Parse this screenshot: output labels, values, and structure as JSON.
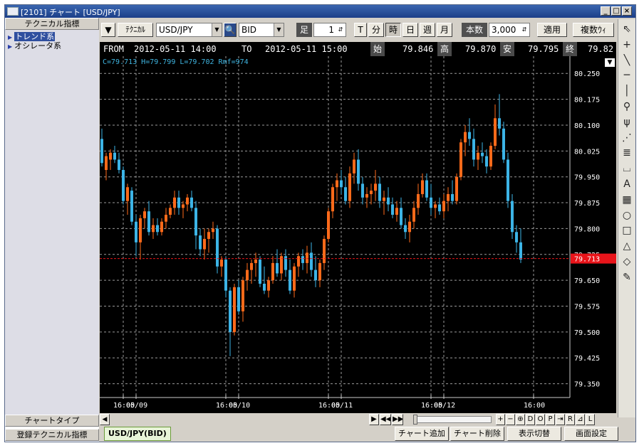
{
  "window": {
    "title": "[2101] チャート [USD/JPY]"
  },
  "left_panel": {
    "header": "テクニカル指標",
    "items": [
      {
        "label": "トレンド系",
        "selected": true
      },
      {
        "label": "オシレータ系",
        "selected": false
      }
    ],
    "chart_type_button": "チャートタイプ",
    "registered_button": "登録テクニカル指標"
  },
  "toolbar": {
    "technical_button": "ﾃｸﾆｶﾙ",
    "symbol": "USD/JPY",
    "price_type": "BID",
    "bar_label": "足",
    "bar_count": "1",
    "tf_buttons": [
      "T",
      "分",
      "時",
      "日",
      "週",
      "月"
    ],
    "active_tf": "時",
    "count_label": "本数",
    "count_value": "3,000",
    "apply_button": "適用",
    "multi_button": "複数ｳｨ"
  },
  "info_bar": {
    "from_label": "FROM",
    "from_value": "2012-05-11  14:00",
    "to_label": "TO",
    "to_value": "2012-05-11  15:00",
    "open_label": "始",
    "open_value": "79.846",
    "high_label": "高",
    "high_value": "79.870",
    "low_label": "安",
    "low_value": "79.795",
    "close_label": "終",
    "close_value": "79.82"
  },
  "chart_data": {
    "type": "candlestick",
    "ohlc_readout": "C=79.713 H=79.799 L=79.702 Rmf=974",
    "last_price_label": "79.713",
    "last_price": 79.713,
    "ylim": [
      79.31,
      80.3
    ],
    "y_ticks": [
      79.35,
      79.425,
      79.5,
      79.575,
      79.65,
      79.725,
      79.8,
      79.875,
      79.95,
      80.025,
      80.1,
      80.175,
      80.25
    ],
    "y_tick_labels": [
      "79.350",
      "79.425",
      "79.500",
      "79.575",
      "79.650",
      "79.725",
      "79.800",
      "79.875",
      "79.950",
      "80.025",
      "80.100",
      "80.175",
      "80.250"
    ],
    "x_labels": [
      {
        "index": 5,
        "text": "16:00"
      },
      {
        "index": 8,
        "text": "05/09"
      },
      {
        "index": 29,
        "text": "16:00"
      },
      {
        "index": 32,
        "text": "05/10"
      },
      {
        "index": 53,
        "text": "16:00"
      },
      {
        "index": 56,
        "text": "05/11"
      },
      {
        "index": 77,
        "text": "16:00"
      },
      {
        "index": 80,
        "text": "05/12"
      },
      {
        "index": 101,
        "text": "16:00"
      }
    ],
    "up_color": "#ff6a1a",
    "down_color": "#3cb4e6",
    "candles": [
      {
        "o": 80.06,
        "h": 80.09,
        "l": 79.98,
        "c": 79.99
      },
      {
        "o": 79.97,
        "h": 80.02,
        "l": 79.94,
        "c": 80.01
      },
      {
        "o": 80.0,
        "h": 80.03,
        "l": 79.97,
        "c": 80.02
      },
      {
        "o": 80.02,
        "h": 80.04,
        "l": 79.99,
        "c": 80.0
      },
      {
        "o": 80.0,
        "h": 80.02,
        "l": 79.96,
        "c": 79.97
      },
      {
        "o": 79.97,
        "h": 79.98,
        "l": 79.87,
        "c": 79.88
      },
      {
        "o": 79.88,
        "h": 79.93,
        "l": 79.84,
        "c": 79.92
      },
      {
        "o": 79.91,
        "h": 79.92,
        "l": 79.81,
        "c": 79.82
      },
      {
        "o": 79.82,
        "h": 79.84,
        "l": 79.72,
        "c": 79.76
      },
      {
        "o": 79.76,
        "h": 79.84,
        "l": 79.71,
        "c": 79.83
      },
      {
        "o": 79.83,
        "h": 79.86,
        "l": 79.8,
        "c": 79.85
      },
      {
        "o": 79.85,
        "h": 79.88,
        "l": 79.78,
        "c": 79.79
      },
      {
        "o": 79.79,
        "h": 79.83,
        "l": 79.77,
        "c": 79.81
      },
      {
        "o": 79.81,
        "h": 79.83,
        "l": 79.78,
        "c": 79.79
      },
      {
        "o": 79.79,
        "h": 79.83,
        "l": 79.78,
        "c": 79.82
      },
      {
        "o": 79.82,
        "h": 79.86,
        "l": 79.8,
        "c": 79.84
      },
      {
        "o": 79.84,
        "h": 79.87,
        "l": 79.83,
        "c": 79.86
      },
      {
        "o": 79.86,
        "h": 79.91,
        "l": 79.84,
        "c": 79.89
      },
      {
        "o": 79.89,
        "h": 79.91,
        "l": 79.84,
        "c": 79.86
      },
      {
        "o": 79.86,
        "h": 79.88,
        "l": 79.83,
        "c": 79.87
      },
      {
        "o": 79.87,
        "h": 79.9,
        "l": 79.85,
        "c": 79.89
      },
      {
        "o": 79.89,
        "h": 79.91,
        "l": 79.85,
        "c": 79.86
      },
      {
        "o": 79.86,
        "h": 79.88,
        "l": 79.74,
        "c": 79.78
      },
      {
        "o": 79.78,
        "h": 79.8,
        "l": 79.72,
        "c": 79.74
      },
      {
        "o": 79.74,
        "h": 79.8,
        "l": 79.71,
        "c": 79.77
      },
      {
        "o": 79.77,
        "h": 79.8,
        "l": 79.73,
        "c": 79.79
      },
      {
        "o": 79.79,
        "h": 79.82,
        "l": 79.77,
        "c": 79.8
      },
      {
        "o": 79.8,
        "h": 79.81,
        "l": 79.67,
        "c": 79.69
      },
      {
        "o": 79.69,
        "h": 79.72,
        "l": 79.66,
        "c": 79.71
      },
      {
        "o": 79.71,
        "h": 79.72,
        "l": 79.6,
        "c": 79.62
      },
      {
        "o": 79.62,
        "h": 79.63,
        "l": 79.43,
        "c": 79.5
      },
      {
        "o": 79.5,
        "h": 79.64,
        "l": 79.49,
        "c": 79.63
      },
      {
        "o": 79.63,
        "h": 79.65,
        "l": 79.55,
        "c": 79.56
      },
      {
        "o": 79.56,
        "h": 79.66,
        "l": 79.53,
        "c": 79.65
      },
      {
        "o": 79.65,
        "h": 79.7,
        "l": 79.62,
        "c": 79.68
      },
      {
        "o": 79.68,
        "h": 79.71,
        "l": 79.64,
        "c": 79.7
      },
      {
        "o": 79.7,
        "h": 79.73,
        "l": 79.66,
        "c": 79.71
      },
      {
        "o": 79.71,
        "h": 79.72,
        "l": 79.63,
        "c": 79.64
      },
      {
        "o": 79.64,
        "h": 79.69,
        "l": 79.61,
        "c": 79.62
      },
      {
        "o": 79.62,
        "h": 79.66,
        "l": 79.6,
        "c": 79.65
      },
      {
        "o": 79.65,
        "h": 79.72,
        "l": 79.64,
        "c": 79.7
      },
      {
        "o": 79.7,
        "h": 79.74,
        "l": 79.66,
        "c": 79.67
      },
      {
        "o": 79.67,
        "h": 79.73,
        "l": 79.65,
        "c": 79.72
      },
      {
        "o": 79.72,
        "h": 79.74,
        "l": 79.66,
        "c": 79.68
      },
      {
        "o": 79.68,
        "h": 79.71,
        "l": 79.61,
        "c": 79.62
      },
      {
        "o": 79.62,
        "h": 79.7,
        "l": 79.6,
        "c": 79.69
      },
      {
        "o": 79.69,
        "h": 79.73,
        "l": 79.66,
        "c": 79.72
      },
      {
        "o": 79.72,
        "h": 79.74,
        "l": 79.68,
        "c": 79.7
      },
      {
        "o": 79.7,
        "h": 79.75,
        "l": 79.67,
        "c": 79.73
      },
      {
        "o": 79.73,
        "h": 79.76,
        "l": 79.66,
        "c": 79.68
      },
      {
        "o": 79.68,
        "h": 79.72,
        "l": 79.63,
        "c": 79.65
      },
      {
        "o": 79.65,
        "h": 79.71,
        "l": 79.63,
        "c": 79.7
      },
      {
        "o": 79.7,
        "h": 79.78,
        "l": 79.68,
        "c": 79.77
      },
      {
        "o": 79.77,
        "h": 79.86,
        "l": 79.76,
        "c": 79.85
      },
      {
        "o": 79.85,
        "h": 79.93,
        "l": 79.83,
        "c": 79.92
      },
      {
        "o": 79.92,
        "h": 79.96,
        "l": 79.88,
        "c": 79.94
      },
      {
        "o": 79.94,
        "h": 79.97,
        "l": 79.9,
        "c": 79.92
      },
      {
        "o": 79.92,
        "h": 79.95,
        "l": 79.87,
        "c": 79.88
      },
      {
        "o": 79.88,
        "h": 79.98,
        "l": 79.86,
        "c": 79.96
      },
      {
        "o": 79.96,
        "h": 80.02,
        "l": 79.93,
        "c": 80.0
      },
      {
        "o": 80.0,
        "h": 80.03,
        "l": 79.91,
        "c": 79.93
      },
      {
        "o": 79.93,
        "h": 79.95,
        "l": 79.87,
        "c": 79.89
      },
      {
        "o": 79.89,
        "h": 79.92,
        "l": 79.86,
        "c": 79.9
      },
      {
        "o": 79.9,
        "h": 79.93,
        "l": 79.87,
        "c": 79.91
      },
      {
        "o": 79.91,
        "h": 79.97,
        "l": 79.88,
        "c": 79.93
      },
      {
        "o": 79.93,
        "h": 79.95,
        "l": 79.86,
        "c": 79.88
      },
      {
        "o": 79.88,
        "h": 79.91,
        "l": 79.84,
        "c": 79.89
      },
      {
        "o": 79.89,
        "h": 79.92,
        "l": 79.85,
        "c": 79.87
      },
      {
        "o": 79.87,
        "h": 79.89,
        "l": 79.83,
        "c": 79.84
      },
      {
        "o": 79.84,
        "h": 79.88,
        "l": 79.82,
        "c": 79.86
      },
      {
        "o": 79.86,
        "h": 79.89,
        "l": 79.8,
        "c": 79.81
      },
      {
        "o": 79.81,
        "h": 79.83,
        "l": 79.77,
        "c": 79.79
      },
      {
        "o": 79.79,
        "h": 79.84,
        "l": 79.76,
        "c": 79.82
      },
      {
        "o": 79.82,
        "h": 79.88,
        "l": 79.8,
        "c": 79.86
      },
      {
        "o": 79.86,
        "h": 79.93,
        "l": 79.84,
        "c": 79.9
      },
      {
        "o": 79.9,
        "h": 79.96,
        "l": 79.89,
        "c": 79.94
      },
      {
        "o": 79.94,
        "h": 79.96,
        "l": 79.88,
        "c": 79.89
      },
      {
        "o": 79.89,
        "h": 79.93,
        "l": 79.84,
        "c": 79.86
      },
      {
        "o": 79.86,
        "h": 79.88,
        "l": 79.83,
        "c": 79.87
      },
      {
        "o": 79.87,
        "h": 79.89,
        "l": 79.84,
        "c": 79.85
      },
      {
        "o": 79.85,
        "h": 79.9,
        "l": 79.83,
        "c": 79.88
      },
      {
        "o": 79.88,
        "h": 79.92,
        "l": 79.85,
        "c": 79.9
      },
      {
        "o": 79.9,
        "h": 79.94,
        "l": 79.87,
        "c": 79.88
      },
      {
        "o": 79.88,
        "h": 79.96,
        "l": 79.87,
        "c": 79.95
      },
      {
        "o": 79.95,
        "h": 80.06,
        "l": 79.94,
        "c": 80.05
      },
      {
        "o": 80.05,
        "h": 80.1,
        "l": 80.01,
        "c": 80.08
      },
      {
        "o": 80.08,
        "h": 80.12,
        "l": 80.04,
        "c": 80.06
      },
      {
        "o": 80.06,
        "h": 80.09,
        "l": 79.98,
        "c": 80.0
      },
      {
        "o": 80.0,
        "h": 80.04,
        "l": 79.97,
        "c": 80.02
      },
      {
        "o": 80.02,
        "h": 80.05,
        "l": 79.99,
        "c": 80.01
      },
      {
        "o": 80.01,
        "h": 80.03,
        "l": 79.96,
        "c": 79.98
      },
      {
        "o": 79.98,
        "h": 80.05,
        "l": 79.97,
        "c": 80.04
      },
      {
        "o": 80.04,
        "h": 80.16,
        "l": 80.03,
        "c": 80.12
      },
      {
        "o": 80.12,
        "h": 80.19,
        "l": 80.07,
        "c": 80.09
      },
      {
        "o": 80.09,
        "h": 80.11,
        "l": 79.99,
        "c": 80.0
      },
      {
        "o": 80.0,
        "h": 80.02,
        "l": 79.86,
        "c": 79.88
      },
      {
        "o": 79.88,
        "h": 79.9,
        "l": 79.77,
        "c": 79.79
      },
      {
        "o": 79.79,
        "h": 79.81,
        "l": 79.73,
        "c": 79.76
      },
      {
        "o": 79.76,
        "h": 79.8,
        "l": 79.7,
        "c": 79.71
      }
    ]
  },
  "right_tools": [
    "cursor-icon",
    "crosshair-icon",
    "trendline-icon",
    "horizontal-line-icon",
    "vertical-line-icon",
    "pitchfork-icon",
    "fan-icon",
    "gann-icon",
    "fibonacci-icon",
    "arc-icon",
    "text-icon",
    "grid-icon",
    "ellipse-icon",
    "rectangle-icon",
    "triangle-icon",
    "eraser-icon",
    "delete-all-icon"
  ],
  "right_tool_glyphs": {
    "cursor-icon": "⇖",
    "crosshair-icon": "+",
    "trendline-icon": "╲",
    "horizontal-line-icon": "─",
    "vertical-line-icon": "│",
    "pitchfork-icon": "⚲",
    "fan-icon": "ψ",
    "gann-icon": "⋰",
    "fibonacci-icon": "≣",
    "arc-icon": "⌴",
    "text-icon": "A",
    "grid-icon": "▦",
    "ellipse-icon": "○",
    "rectangle-icon": "□",
    "triangle-icon": "△",
    "eraser-icon": "◇",
    "delete-all-icon": "✎"
  },
  "scroll_controls": [
    "▶",
    "◀◀",
    "▶▶",
    "+",
    "−",
    "⊕",
    "D",
    "O",
    "P",
    "⇥",
    "R",
    "⊿",
    "L"
  ],
  "bottom_tabs": {
    "active_tab": "USD/JPY(BID)",
    "add_chart": "チャート追加",
    "delete_chart": "チャート削除",
    "toggle_display": "表示切替",
    "screen_settings": "画面設定"
  },
  "colors": {
    "last_price_bg": "#e8141a",
    "grid": "#9a9a9a"
  }
}
